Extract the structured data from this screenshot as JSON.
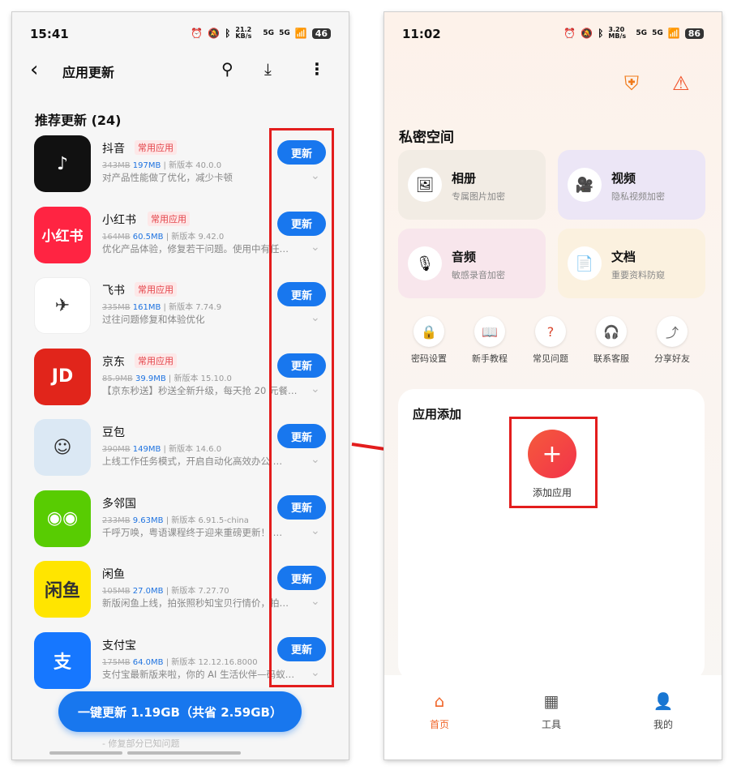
{
  "left": {
    "status": {
      "time": "15:41",
      "net": "21.2 KB/s",
      "signal1": "5G",
      "signal2": "5G",
      "battery": "46"
    },
    "title": "应用更新",
    "section": "推荐更新 (24)",
    "update_label": "更新",
    "apps": [
      {
        "name": "抖音",
        "tag": "常用应用",
        "old": "343MB",
        "new": "197MB",
        "ver": "新版本 40.0.0",
        "desc": "对产品性能做了优化，减少卡顿",
        "icon_text": "♪",
        "color": "#111111"
      },
      {
        "name": "小红书",
        "tag": "常用应用",
        "old": "164MB",
        "new": "60.5MB",
        "ver": "新版本 9.42.0",
        "desc": "优化产品体验，修复若干问题。使用中有任…",
        "icon_text": "小红书",
        "color": "#ff2442"
      },
      {
        "name": "飞书",
        "tag": "常用应用",
        "old": "335MB",
        "new": "161MB",
        "ver": "新版本 7.74.9",
        "desc": "过往问题修复和体验优化",
        "icon_text": "✈",
        "color": "#ffffff"
      },
      {
        "name": "京东",
        "tag": "常用应用",
        "old": "85.9MB",
        "new": "39.9MB",
        "ver": "新版本 15.10.0",
        "desc": "【京东秒送】秒送全新升级，每天抢 20 元餐…",
        "icon_text": "JD",
        "color": "#e1251b"
      },
      {
        "name": "豆包",
        "tag": "",
        "old": "390MB",
        "new": "149MB",
        "ver": "新版本 14.6.0",
        "desc": "上线工作任务模式，开启自动化高效办公 …",
        "icon_text": "☺",
        "color": "#dbe8f4"
      },
      {
        "name": "多邻国",
        "tag": "",
        "old": "233MB",
        "new": "9.63MB",
        "ver": "新版本 6.91.5-china",
        "desc": "千呼万唤，粤语课程终于迎来重磅更新！ …",
        "icon_text": "◉◉",
        "color": "#58cc02"
      },
      {
        "name": "闲鱼",
        "tag": "",
        "old": "105MB",
        "new": "27.0MB",
        "ver": "新版本 7.27.70",
        "desc": "新版闲鱼上线，拍张照秒知宝贝行情价，拍…",
        "icon_text": "闲鱼",
        "color": "#ffe500"
      },
      {
        "name": "支付宝",
        "tag": "",
        "old": "175MB",
        "new": "64.0MB",
        "ver": "新版本 12.12.16.8000",
        "desc": "支付宝最新版来啦，你的 AI 生活伙伴—码蚁…",
        "icon_text": "支",
        "color": "#1677ff"
      }
    ],
    "bottom_button": "一键更新 1.19GB（共省 2.59GB）",
    "hidden_row_desc": "- 修复部分已知问题"
  },
  "right": {
    "status": {
      "time": "11:02",
      "net": "3.20 MB/s",
      "signal1": "5G",
      "signal2": "5G",
      "battery": "86"
    },
    "section_title": "私密空间",
    "cards": [
      {
        "title": "相册",
        "sub": "专属图片加密",
        "icon": "🖼",
        "bg": "#f2ece4"
      },
      {
        "title": "视频",
        "sub": "隐私视频加密",
        "icon": "🎥",
        "bg": "#ece6f6"
      },
      {
        "title": "音频",
        "sub": "敏感录音加密",
        "icon": "🎙",
        "bg": "#f8e6ec"
      },
      {
        "title": "文档",
        "sub": "重要资料防窥",
        "icon": "📄",
        "bg": "#fbf1df"
      }
    ],
    "quick": [
      {
        "label": "密码设置",
        "icon": "🔒"
      },
      {
        "label": "新手教程",
        "icon": "📖"
      },
      {
        "label": "常见问题",
        "icon": "?"
      },
      {
        "label": "联系客服",
        "icon": "🎧"
      },
      {
        "label": "分享好友",
        "icon": "⤴"
      }
    ],
    "add_title": "应用添加",
    "add_label": "添加应用",
    "tabs": [
      {
        "label": "首页",
        "icon": "⌂"
      },
      {
        "label": "工具",
        "icon": "▦"
      },
      {
        "label": "我的",
        "icon": "👤"
      }
    ]
  }
}
